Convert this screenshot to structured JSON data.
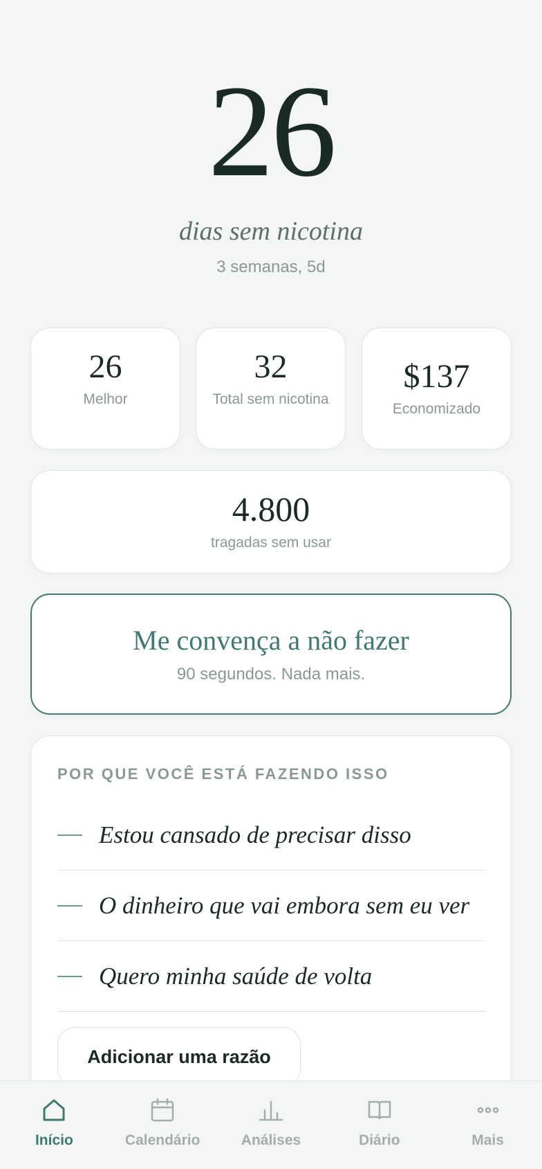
{
  "hero": {
    "days": "26",
    "subtitle": "dias sem nicotina",
    "detail": "3 semanas, 5d"
  },
  "stats": [
    {
      "value": "26",
      "label": "Melhor"
    },
    {
      "value": "32",
      "label": "Total sem nicotina"
    },
    {
      "value": "$137",
      "label": "Economizado"
    }
  ],
  "puffs": {
    "value": "4.800",
    "label": "tragadas sem usar"
  },
  "convince": {
    "title": "Me convença a não fazer",
    "subtitle": "90 segundos. Nada mais."
  },
  "reasons": {
    "heading": "POR QUE VOCÊ ESTÁ FAZENDO ISSO",
    "items": [
      "Estou cansado de precisar disso",
      "O dinheiro que vai embora sem eu ver",
      "Quero minha saúde de volta"
    ],
    "add_label": "Adicionar uma razão"
  },
  "nav": {
    "items": [
      {
        "label": "Início",
        "icon": "home-icon",
        "active": true
      },
      {
        "label": "Calendário",
        "icon": "calendar-icon"
      },
      {
        "label": "Análises",
        "icon": "bar-chart-icon"
      },
      {
        "label": "Diário",
        "icon": "book-icon"
      },
      {
        "label": "Mais",
        "icon": "more-icon"
      }
    ]
  },
  "colors": {
    "accent": "#3f7a70",
    "background": "#f4f6f5",
    "muted": "#8a9994"
  }
}
